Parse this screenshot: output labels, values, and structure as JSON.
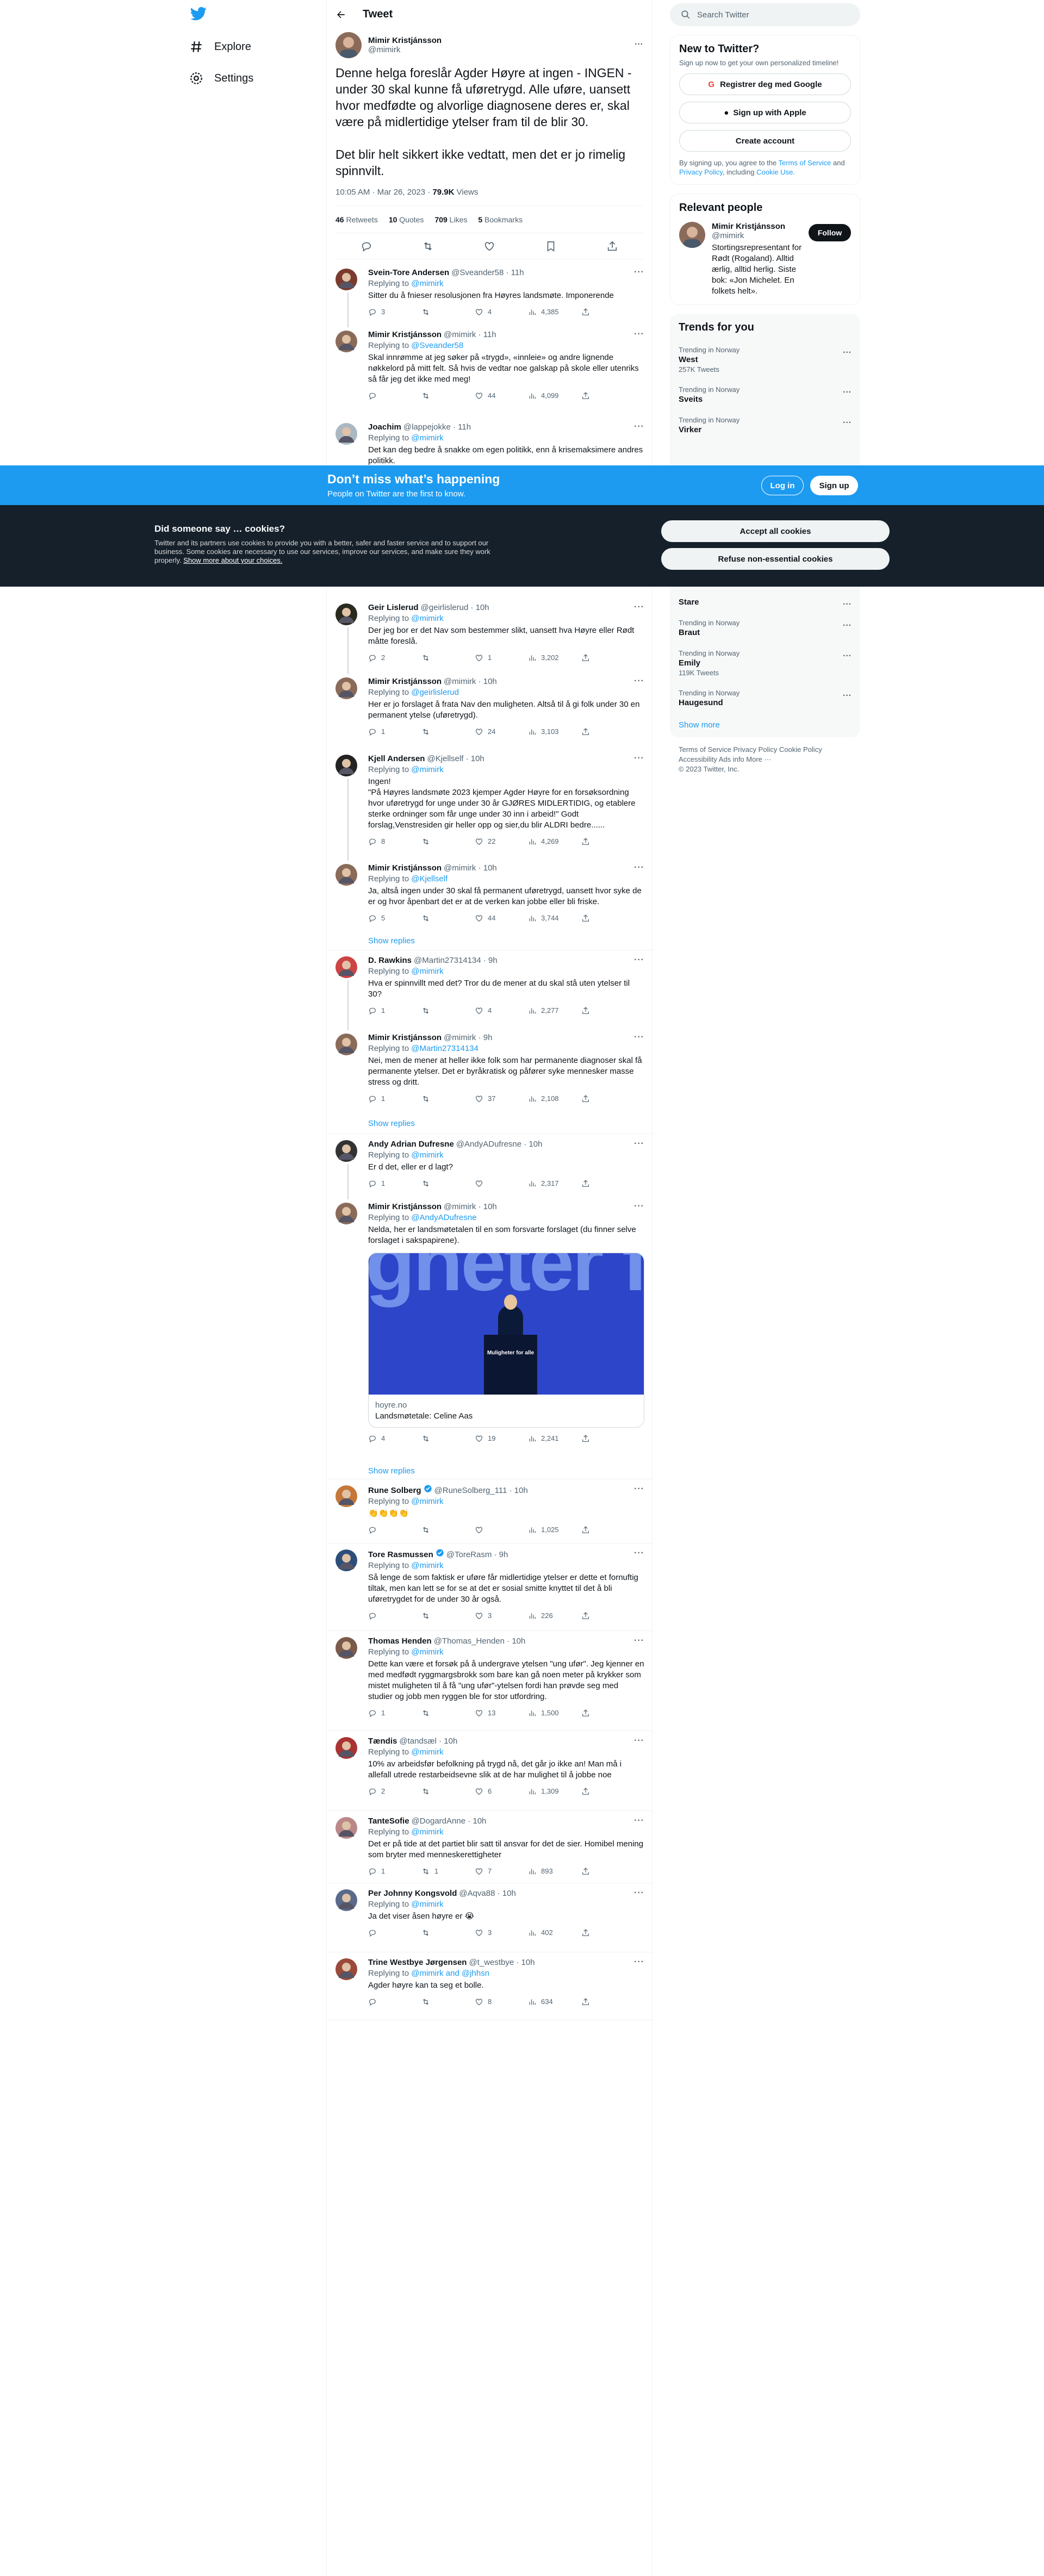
{
  "nav": {
    "explore": "Explore",
    "settings": "Settings"
  },
  "header": {
    "title": "Tweet"
  },
  "focus": {
    "name": "Mimir Kristjánsson",
    "handle": "@mimirk",
    "text": "Denne helga foreslår Agder Høyre at ingen - INGEN - under 30 skal kunne få uføretrygd. Alle uføre, uansett hvor medfødte og alvorlige diagnosene deres er, skal være på midlertidige ytelser fram til de blir 30.\n\nDet blir helt sikkert ikke vedtatt, men det er jo rimelig spinnvilt.",
    "time": "10:05 AM · Mar 26, 2023 · ",
    "views": "79.9K",
    "views_label": " Views",
    "retweets": "46",
    "retweets_label": " Retweets",
    "quotes": "10",
    "quotes_label": " Quotes",
    "likes": "709",
    "likes_label": " Likes",
    "bookmarks": "5",
    "bookmarks_label": " Bookmarks"
  },
  "replies": [
    {
      "name": "Svein-Tore Andersen",
      "handle": "@Sveander58 · 11h",
      "reply_to": "@mimirk",
      "text": "Sitter du å fnieser resolusjonen fra Høyres landsmøte. Imponerende",
      "r": "3",
      "rt": "",
      "l": "4",
      "v": "4,385"
    },
    {
      "name": "Mimir Kristjánsson",
      "handle": "@mimirk · 11h",
      "reply_to": "@Sveander58",
      "text": "Skal innrømme at jeg søker på «trygd», «innleie» og andre lignende nøkkelord på mitt felt. Så hvis de vedtar noe galskap på skole eller utenriks så får jeg det ikke med meg!",
      "r": "",
      "rt": "",
      "l": "44",
      "v": "4,099"
    },
    {
      "name": "Joachim",
      "handle": "@lappejokke · 11h",
      "reply_to": "@mimirk",
      "text": "Det kan deg bedre å snakke om egen politikk, enn å krisemaksimere andres politikk.",
      "r": "",
      "rt": "",
      "l": "",
      "v": ""
    },
    {
      "name": "Geir Lislerud",
      "handle": "@geirlislerud · 10h",
      "reply_to": "@mimirk",
      "text": "Der jeg bor er det Nav som bestemmer slikt, uansett hva Høyre eller Rødt måtte foreslå.",
      "r": "2",
      "rt": "",
      "l": "1",
      "v": "3,202"
    },
    {
      "name": "Mimir Kristjánsson",
      "handle": "@mimirk · 10h",
      "reply_to": "@geirlislerud",
      "text": "Her er jo forslaget å frata Nav den muligheten. Altså til å gi folk under 30 en permanent ytelse (uføretrygd).",
      "r": "1",
      "rt": "",
      "l": "24",
      "v": "3,103"
    },
    {
      "name": "Kjell Andersen",
      "handle": "@Kjellself · 10h",
      "reply_to": "@mimirk",
      "text": "Ingen!\n\"På Høyres landsmøte 2023 kjemper Agder Høyre for en forsøksordning hvor uføretrygd for unge under 30 år GJØRES MIDLERTIDIG, og etablere sterke ordninger som får unge under 30 inn i arbeid!\" Godt forslag,Venstresiden gir heller opp og sier,du blir ALDRI bedre......",
      "r": "8",
      "rt": "",
      "l": "22",
      "v": "4,269"
    },
    {
      "name": "Mimir Kristjánsson",
      "handle": "@mimirk · 10h",
      "reply_to": "@Kjellself",
      "text": "Ja, altså ingen under 30 skal få permanent uføretrygd, uansett hvor syke de er og hvor åpenbart det er at de verken kan jobbe eller bli friske.",
      "r": "5",
      "rt": "",
      "l": "44",
      "v": "3,744"
    },
    {
      "name": "D. Rawkins",
      "handle": "@Martin27314134 · 9h",
      "reply_to": "@mimirk",
      "text": "Hva er spinnvillt med det? Tror du de mener at du skal stå uten ytelser til 30?",
      "r": "1",
      "rt": "",
      "l": "4",
      "v": "2,277"
    },
    {
      "name": "Mimir Kristjánsson",
      "handle": "@mimirk · 9h",
      "reply_to": "@Martin27314134",
      "text": "Nei, men de mener at heller ikke folk som har permanente diagnoser skal få permanente ytelser. Det er byråkratisk og påfører syke mennesker masse stress og dritt.",
      "r": "1",
      "rt": "",
      "l": "37",
      "v": "2,108"
    },
    {
      "name": "Andy Adrian Dufresne",
      "handle": "@AndyADufresne · 10h",
      "reply_to": "@mimirk",
      "text": "Er d det, eller er d lagt?",
      "r": "1",
      "rt": "",
      "l": "",
      "v": "2,317"
    },
    {
      "name": "Mimir Kristjánsson",
      "handle": "@mimirk · 10h",
      "reply_to": "@AndyADufresne",
      "text": "Nelda, her er landsmøtetalen til en som forsvarte forslaget (du finner selve forslaget i sakspapirene).",
      "r": "4",
      "rt": "",
      "l": "19",
      "v": "2,241"
    },
    {
      "name": "Rune Solberg",
      "handle": "@RuneSolberg_111 · 10h",
      "reply_to": "@mimirk",
      "text": "👏👏👏👏",
      "r": "",
      "rt": "",
      "l": "",
      "v": "1,025"
    },
    {
      "name": "Tore Rasmussen",
      "handle": "@ToreRasm · 9h",
      "reply_to": "@mimirk",
      "text": "Så lenge de som faktisk er uføre får midlertidige ytelser er dette et fornuftig tiltak, men kan lett se for se at det er sosial smitte knyttet til det å bli uføretrygdet for de under 30 år også.",
      "r": "",
      "rt": "",
      "l": "3",
      "v": "226"
    },
    {
      "name": "Thomas Henden",
      "handle": "@Thomas_Henden · 10h",
      "reply_to": "@mimirk",
      "text": "Dette kan være et forsøk på å undergrave ytelsen \"ung ufør\". Jeg kjenner en med medfødt ryggmargsbrokk som bare kan gå noen meter på krykker som mistet muligheten til å få \"ung ufør\"-ytelsen fordi han prøvde seg med studier og jobb men ryggen ble for stor utfordring.",
      "r": "1",
      "rt": "",
      "l": "13",
      "v": "1,500"
    },
    {
      "name": "Tændis",
      "handle": "@tandsæl · 10h",
      "reply_to": "@mimirk",
      "text": "10% av arbeidsfør befolkning på trygd nå, det går jo ikke an! Man må i allefall utrede restarbeidsevne slik at de har mulighet til å jobbe noe",
      "r": "2",
      "rt": "",
      "l": "6",
      "v": "1,309"
    },
    {
      "name": "TanteSofie",
      "handle": "@DogardAnne · 10h",
      "reply_to": "@mimirk",
      "text": "Det er på tide at det partiet blir satt til ansvar for det de sier. Homibel mening som bryter med menneskerettigheter",
      "r": "1",
      "rt": "1",
      "l": "7",
      "v": "893"
    },
    {
      "name": "Per Johnny Kongsvold",
      "handle": "@Aqva88 · 10h",
      "reply_to": "@mimirk",
      "text": "Ja det viser åsen høyre er 😭",
      "r": "",
      "rt": "",
      "l": "3",
      "v": "402"
    },
    {
      "name": "Trine Westbye Jørgensen",
      "handle": "@t_westbye · 10h",
      "reply_to": "@mimirk and @jhhsn",
      "text": "Agder høyre kan ta seg et bolle.",
      "r": "",
      "rt": "",
      "l": "8",
      "v": "634"
    }
  ],
  "replying_label": "Replying to ",
  "show_replies": "Show replies",
  "link_card": {
    "domain": "hoyre.no",
    "title": "Landsmøtetale: Celine Aas",
    "image_text": "gheter fo",
    "podium_text": "Muligheter for alle"
  },
  "right": {
    "search_placeholder": "Search Twitter",
    "new_title": "New to Twitter?",
    "new_sub": "Sign up now to get your own personalized timeline!",
    "google": "Registrer deg med Google",
    "apple": "Sign up with Apple",
    "create": "Create account",
    "legal_pre": "By signing up, you agree to the ",
    "terms": "Terms of Service",
    "legal_and": " and ",
    "privacy": "Privacy Policy",
    "legal_incl": ", including ",
    "cookie_use": "Cookie Use.",
    "relevant_title": "Relevant people",
    "person_name": "Mimir Kristjánsson",
    "person_handle": "@mimirk",
    "person_bio": "Stortingsrepresentant for Rødt (Rogaland). Alltid ærlig, alltid herlig. Siste bok: «Jon Michelet. En folkets helt».",
    "follow": "Follow",
    "trends_title": "Trends for you",
    "trends": [
      {
        "ctx": "Trending in Norway",
        "name": "West",
        "count": "257K Tweets"
      },
      {
        "ctx": "Trending in Norway",
        "name": "Sveits",
        "count": ""
      },
      {
        "ctx": "Trending in Norway",
        "name": "Virker",
        "count": ""
      },
      {
        "ctx": "",
        "name": "Stare",
        "count": ""
      },
      {
        "ctx": "Trending in Norway",
        "name": "Braut",
        "count": ""
      },
      {
        "ctx": "Trending in Norway",
        "name": "Emily",
        "count": "119K Tweets"
      },
      {
        "ctx": "Trending in Norway",
        "name": "Haugesund",
        "count": ""
      }
    ],
    "show_more": "Show more",
    "footer": "Terms of Service   Privacy Policy   Cookie Policy\nAccessibility   Ads info   More ···\n© 2023 Twitter, Inc."
  },
  "banner": {
    "title": "Don’t miss what’s happening",
    "sub": "People on Twitter are the first to know.",
    "login": "Log in",
    "signup": "Sign up"
  },
  "cookie": {
    "title": "Did someone say … cookies?",
    "text": "Twitter and its partners use cookies to provide you with a better, safer and faster service and to support our business. Some cookies are necessary to use our services, improve our services, and make sure they work properly. ",
    "link": "Show more about your choices.",
    "accept": "Accept all cookies",
    "refuse": "Refuse non-essential cookies"
  },
  "colors": {
    "brand": "#1d9bf0",
    "text": "#0f1419",
    "muted": "#536471"
  }
}
